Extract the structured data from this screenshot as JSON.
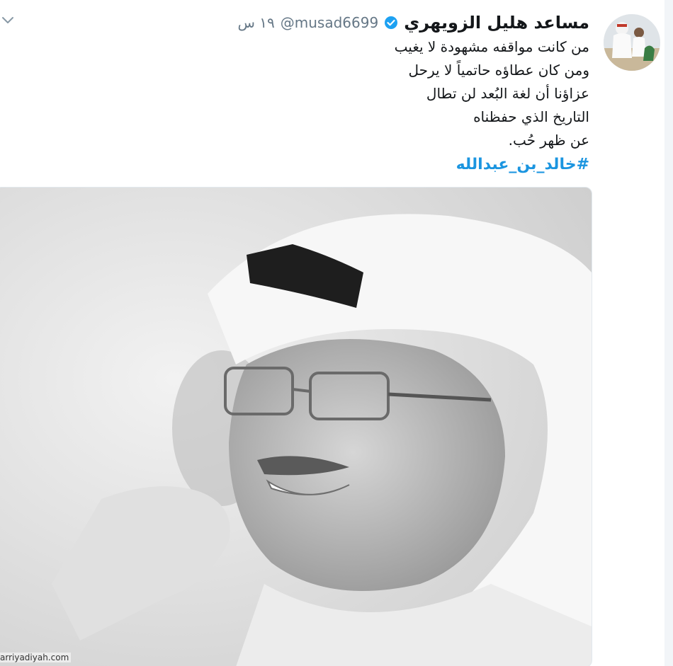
{
  "tweet": {
    "display_name": "مساعد هليل الزويهري",
    "handle": "@musad6699",
    "timestamp": "١٩ س",
    "lines": [
      "من كانت مواقفه مشهودة لا يغيب",
      "ومن كان عطاؤه حاتمياً لا يرحل",
      "عزاؤنا أن لغة البُعد لن تطال",
      " التاريخ الذي حفظناه",
      "عن ظهر حُب."
    ],
    "hashtag": "#خالد_بن_عبدالله"
  },
  "watermark": "arriyadiyah.com",
  "colors": {
    "link": "#1b95e0",
    "verified": "#1da1f2",
    "text": "#14171a",
    "muted": "#657786"
  },
  "icons": {
    "menu": "chevron-down-icon",
    "verified": "verified-badge-icon"
  }
}
